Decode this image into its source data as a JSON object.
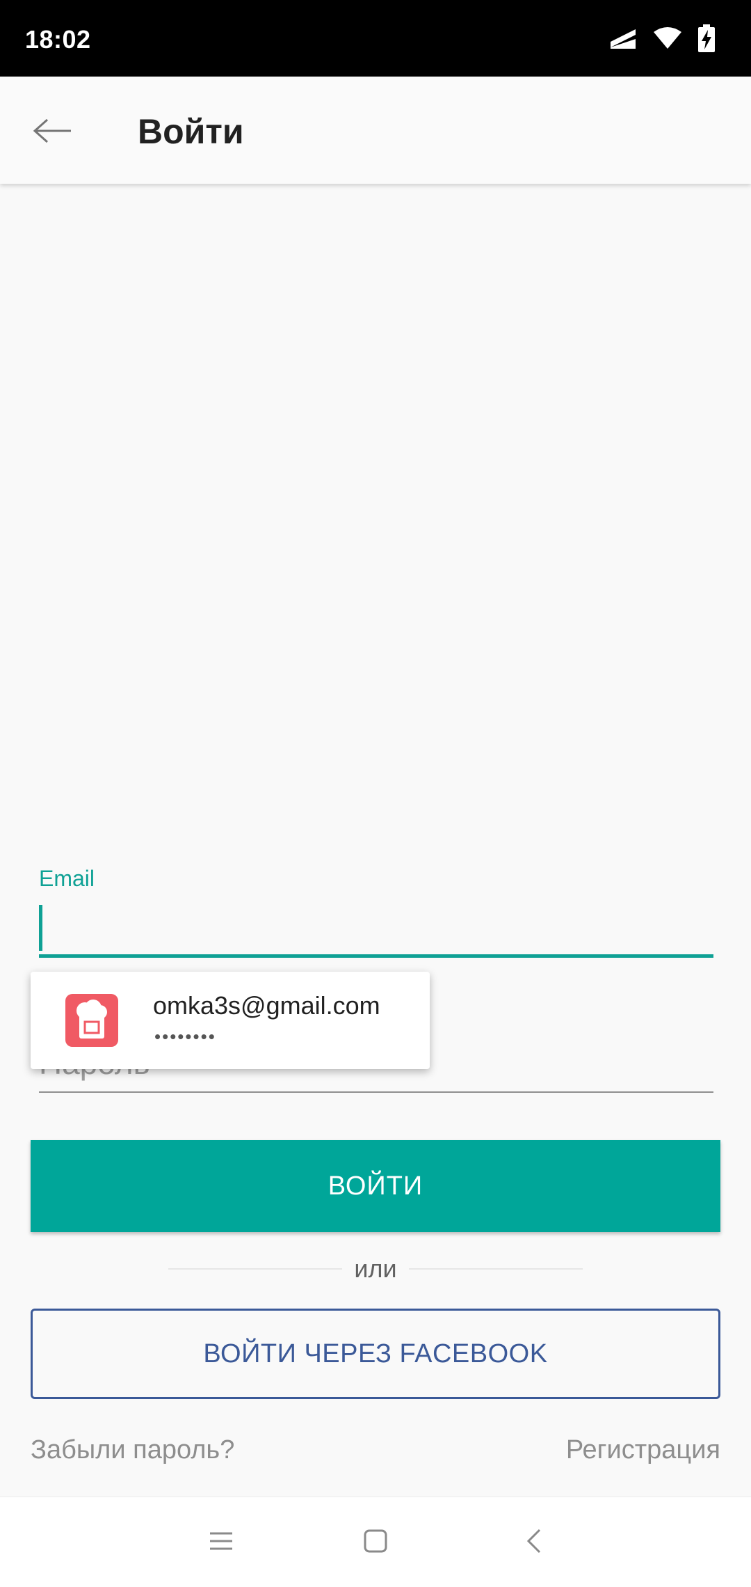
{
  "status_bar": {
    "time": "18:02"
  },
  "app_bar": {
    "title": "Войти"
  },
  "form": {
    "email_label": "Email",
    "email_value": "",
    "password_placeholder": "Пароль"
  },
  "autofill": {
    "email": "omka3s@gmail.com",
    "password_mask": "••••••••"
  },
  "actions": {
    "login_label": "ВОЙТИ",
    "or_label": "или",
    "facebook_label": "ВОЙТИ ЧЕРЕЗ FACEBOOK",
    "forgot_label": "Забыли пароль?",
    "register_label": "Регистрация"
  },
  "colors": {
    "accent": "#00a699",
    "facebook": "#3b5998",
    "autofill_icon_bg": "#f05a64"
  },
  "icons": {
    "status": [
      "signal-icon",
      "wifi-icon",
      "battery-charging-icon"
    ],
    "app_bar": "back-arrow-icon",
    "navigation": [
      "menu-icon",
      "home-icon",
      "back-icon"
    ]
  }
}
